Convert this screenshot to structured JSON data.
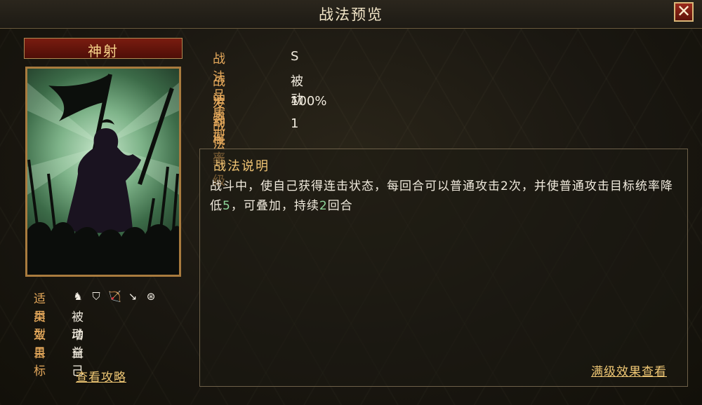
{
  "window": {
    "title": "战法预览",
    "close_icon": "close-icon"
  },
  "skill": {
    "name": "神射",
    "portrait": "archer-general-silhouette",
    "info": {
      "troops_label": "适用",
      "troop_icons": [
        "cavalry-icon",
        "shield-icon",
        "bow-icon",
        "spear-icon",
        "siege-wheel-icon"
      ],
      "type_label": "类型",
      "type_value": "被动",
      "effect_label": "效果",
      "effect_value": "增益",
      "target_label": "目标",
      "target_value": "自己"
    },
    "guide_link": "查看攻略"
  },
  "stats": [
    {
      "label": "战法品质",
      "value": "S"
    },
    {
      "label": "战法类型",
      "value": "被动"
    },
    {
      "label": "发动概率",
      "value": "100%"
    },
    {
      "label": "战法等级",
      "value": "1"
    }
  ],
  "description": {
    "title": "战法说明",
    "part1": "战斗中，使自己获得连击状态，每回合可以普通攻击2次，并使普通攻击目标统率降低",
    "value1": "5",
    "part2": "，可叠加，持续",
    "value2": "2",
    "part3": "回合",
    "highlight_color": "#8fd69a"
  },
  "max_level_link": "满级效果查看",
  "colors": {
    "accent": "#e4a85b",
    "link": "#efc774",
    "title_bar": "#7a1c10"
  }
}
